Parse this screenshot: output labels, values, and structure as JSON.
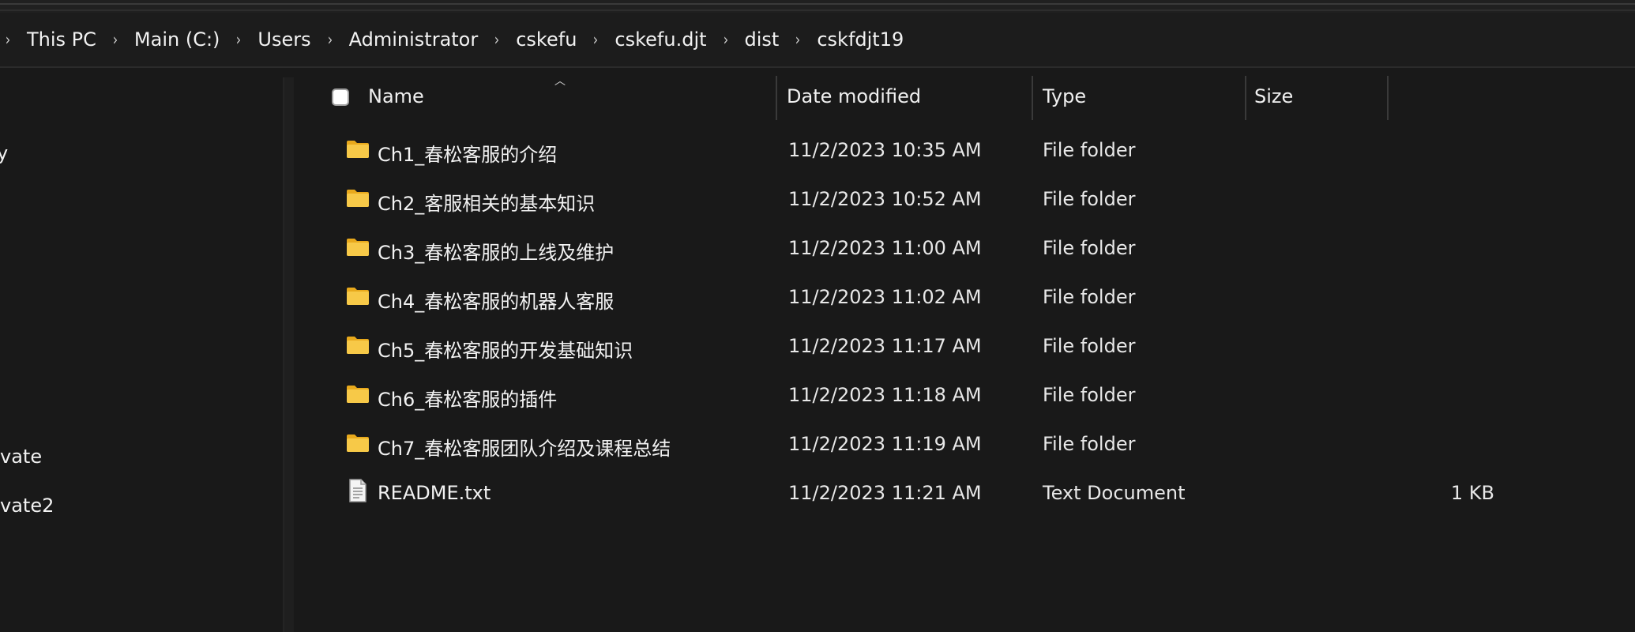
{
  "breadcrumb": [
    "This PC",
    "Main (C:)",
    "Users",
    "Administrator",
    "cskefu",
    "cskefu.djt",
    "dist",
    "cskfdjt19"
  ],
  "nav": {
    "items": [
      "y",
      "vate",
      "vate2"
    ]
  },
  "columns": {
    "name": "Name",
    "date": "Date modified",
    "type": "Type",
    "size": "Size"
  },
  "files": [
    {
      "name": "Ch1_春松客服的介绍",
      "date": "11/2/2023 10:35 AM",
      "type": "File folder",
      "size": "",
      "icon": "folder-icon"
    },
    {
      "name": "Ch2_客服相关的基本知识",
      "date": "11/2/2023 10:52 AM",
      "type": "File folder",
      "size": "",
      "icon": "folder-icon"
    },
    {
      "name": "Ch3_春松客服的上线及维护",
      "date": "11/2/2023 11:00 AM",
      "type": "File folder",
      "size": "",
      "icon": "folder-icon"
    },
    {
      "name": "Ch4_春松客服的机器人客服",
      "date": "11/2/2023 11:02 AM",
      "type": "File folder",
      "size": "",
      "icon": "folder-icon"
    },
    {
      "name": "Ch5_春松客服的开发基础知识",
      "date": "11/2/2023 11:17 AM",
      "type": "File folder",
      "size": "",
      "icon": "folder-icon"
    },
    {
      "name": "Ch6_春松客服的插件",
      "date": "11/2/2023 11:18 AM",
      "type": "File folder",
      "size": "",
      "icon": "folder-icon"
    },
    {
      "name": "Ch7_春松客服团队介绍及课程总结",
      "date": "11/2/2023 11:19 AM",
      "type": "File folder",
      "size": "",
      "icon": "folder-icon"
    },
    {
      "name": "README.txt",
      "date": "11/2/2023 11:21 AM",
      "type": "Text Document",
      "size": "1 KB",
      "icon": "text-file-icon"
    }
  ],
  "colors": {
    "background": "#191919",
    "folder": "#f7c948",
    "text": "#f2f2f2"
  }
}
